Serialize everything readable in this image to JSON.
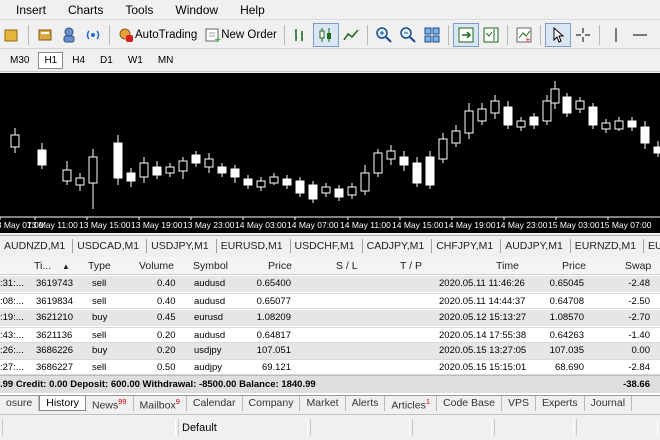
{
  "menu": [
    "Insert",
    "Charts",
    "Tools",
    "Window",
    "Help"
  ],
  "toolbar": {
    "autotrading_label": "AutoTrading",
    "new_order_label": "New Order"
  },
  "timeframes": [
    "M30",
    "H1",
    "H4",
    "D1",
    "W1",
    "MN"
  ],
  "active_timeframe": "H1",
  "chart": {
    "time_labels": [
      "13 May 07:00",
      "13 May 11:00",
      "13 May 15:00",
      "13 May 19:00",
      "13 May 23:00",
      "14 May 03:00",
      "14 May 07:00",
      "14 May 11:00",
      "14 May 15:00",
      "14 May 19:00",
      "14 May 23:00",
      "15 May 03:00",
      "15 May 07:00"
    ],
    "colors": {
      "background": "#000000",
      "candle": "#ffffff"
    }
  },
  "symbol_tabs": [
    "AUDNZD,M1",
    "USDCAD,M1",
    "USDJPY,M1",
    "EURUSD,M1",
    "USDCHF,M1",
    "CADJPY,M1",
    "CHFJPY,M1",
    "AUDJPY,M1",
    "EURNZD,M1",
    "EU"
  ],
  "history": {
    "columns": {
      "ticket": "Ti...",
      "type": "Type",
      "volume": "Volume",
      "symbol": "Symbol",
      "price": "Price",
      "sl": "S / L",
      "tp": "T / P",
      "close_time": "Time",
      "close_price": "Price",
      "swap": "Swap"
    },
    "rows": [
      {
        "open_time": ":31:...",
        "ticket": "3619743",
        "type": "sell",
        "volume": "0.40",
        "symbol": "audusd",
        "price": "0.65400",
        "close_time": "2020.05.11 11:46:26",
        "close_price": "0.65045",
        "swap": "-2.48"
      },
      {
        "open_time": ":08:...",
        "ticket": "3619834",
        "type": "sell",
        "volume": "0.40",
        "symbol": "audusd",
        "price": "0.65077",
        "close_time": "2020.05.11 14:44:37",
        "close_price": "0.64708",
        "swap": "-2.50"
      },
      {
        "open_time": ":19:...",
        "ticket": "3621210",
        "type": "buy",
        "volume": "0.45",
        "symbol": "eurusd",
        "price": "1.08209",
        "close_time": "2020.05.12 15:13:27",
        "close_price": "1.08570",
        "swap": "-2.70"
      },
      {
        "open_time": ":43:...",
        "ticket": "3621136",
        "type": "sell",
        "volume": "0.20",
        "symbol": "audusd",
        "price": "0.64817",
        "close_time": "2020.05.14 17:55:38",
        "close_price": "0.64263",
        "swap": "-1.40"
      },
      {
        "open_time": ":26:...",
        "ticket": "3686226",
        "type": "buy",
        "volume": "0.20",
        "symbol": "usdjpy",
        "price": "107.051",
        "close_time": "2020.05.15 13:27:05",
        "close_price": "107.035",
        "swap": "0.00"
      },
      {
        "open_time": ":27:...",
        "ticket": "3686227",
        "type": "sell",
        "volume": "0.50",
        "symbol": "audjpy",
        "price": "69.121",
        "close_time": "2020.05.15 15:15:01",
        "close_price": "68.690",
        "swap": "-2.84"
      }
    ],
    "balance_line": ".99 Credit: 0.00 Deposit: 600.00 Withdrawal: -8500.00 Balance: 1840.99",
    "balance_swap": "-38.66"
  },
  "bottom_tabs": [
    {
      "label": "osure",
      "badge": ""
    },
    {
      "label": "History",
      "badge": ""
    },
    {
      "label": "News",
      "badge": "99"
    },
    {
      "label": "Mailbox",
      "badge": "9"
    },
    {
      "label": "Calendar",
      "badge": ""
    },
    {
      "label": "Company",
      "badge": ""
    },
    {
      "label": "Market",
      "badge": ""
    },
    {
      "label": "Alerts",
      "badge": ""
    },
    {
      "label": "Articles",
      "badge": "1"
    },
    {
      "label": "Code Base",
      "badge": ""
    },
    {
      "label": "VPS",
      "badge": ""
    },
    {
      "label": "Experts",
      "badge": ""
    },
    {
      "label": "Journal",
      "badge": ""
    }
  ],
  "active_bottom_tab": "History",
  "status": {
    "profile": "Default"
  }
}
